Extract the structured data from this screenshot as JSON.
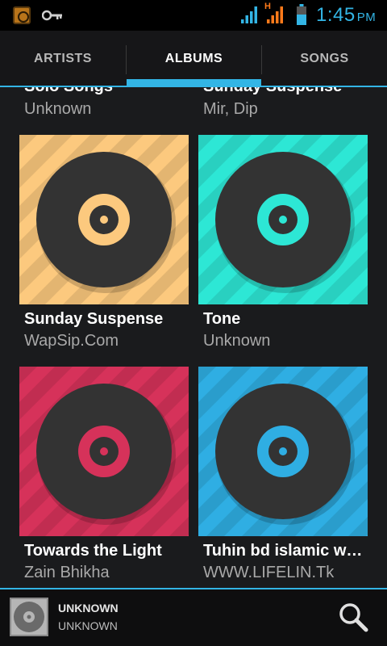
{
  "status_bar": {
    "time": "1:45",
    "ampm": "PM",
    "network_label": "H",
    "icons": [
      "app-notification-icon",
      "key-icon",
      "signal-icon",
      "signal-h-icon",
      "battery-icon"
    ]
  },
  "tabs": [
    {
      "label": "ARTISTS",
      "selected": false
    },
    {
      "label": "ALBUMS",
      "selected": true
    },
    {
      "label": "SONGS",
      "selected": false
    }
  ],
  "colors": {
    "accent": "#33b5e5",
    "tan": "#fcc97e",
    "teal": "#2de7d5",
    "red": "#d6325a",
    "blue": "#2faee3",
    "disc": "#333333"
  },
  "albums": [
    {
      "title": "Solo Songs",
      "artist": "Unknown",
      "color": "#fcc97e",
      "partial": true
    },
    {
      "title": "Sunday Suspense",
      "artist": "Mir, Dip",
      "color": "#2de7d5",
      "partial": true
    },
    {
      "title": "Sunday Suspense",
      "artist": "WapSip.Com",
      "color": "#fcc97e"
    },
    {
      "title": "Tone",
      "artist": "Unknown",
      "color": "#2de7d5"
    },
    {
      "title": "Towards the Light",
      "artist": "Zain Bhikha",
      "color": "#d6325a"
    },
    {
      "title": "Tuhin bd islamic w…",
      "artist": "WWW.LIFELIN.Tk",
      "color": "#2faee3"
    }
  ],
  "now_playing": {
    "title": "UNKNOWN",
    "artist": "UNKNOWN"
  }
}
